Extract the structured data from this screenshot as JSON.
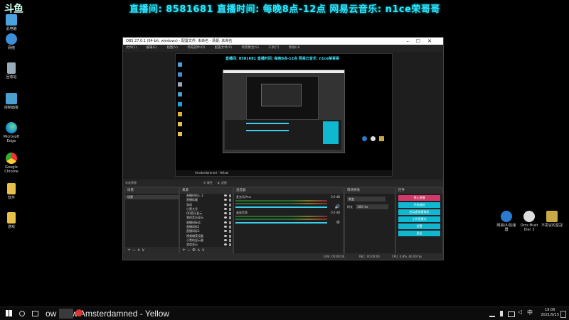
{
  "stream_logo": "斗鱼",
  "stream_banner": "直播间: 8581681 直播时间: 每晚8点-12点 网易云音乐: n1ce荣哥哥",
  "desktop_icons_left": [
    {
      "label": "此电脑",
      "color": "#4aa3df"
    },
    {
      "label": "网络",
      "color": "#3d8fd8"
    },
    {
      "label": "回收站",
      "color": "#9ab"
    },
    {
      "label": "控制面板",
      "color": "#4a9fd0"
    },
    {
      "label": "Microsoft Edge",
      "color": "#1aa1d8"
    },
    {
      "label": "Google Chrome",
      "color": "#e0b030"
    },
    {
      "label": "软件",
      "color": "#e6c04a"
    },
    {
      "label": "游戏",
      "color": "#e6c04a"
    }
  ],
  "desktop_icons_right": [
    {
      "label": "网易UU加速器",
      "color": "#2a7ad0"
    },
    {
      "label": "Orcs Must Die! 3",
      "color": "#ddd"
    },
    {
      "label": "不思议的皇冠",
      "color": "#c9a845"
    }
  ],
  "obs": {
    "title": "OBS 27.0.1 (64-bit, windows) - 配置文件: 未命名 - 场景: 未命名",
    "menu": [
      "文件(F)",
      "编辑(E)",
      "视图(V)",
      "停靠部件(D)",
      "配置文件(P)",
      "场景集合(S)",
      "工具(T)",
      "帮助(H)"
    ],
    "inner_banner": "直播间: 8581681 直播时间: 每晚8点-12点 网易云音乐: n1ce荣哥哥",
    "inner_now_playing": "Amsterdamned - Yellow",
    "scene_bar": {
      "label": "未选择源",
      "props": "属性",
      "filters": "滤镜"
    },
    "docks": {
      "scenes": {
        "title": "场景",
        "items": [
          "场景"
        ]
      },
      "sources": {
        "title": "来源",
        "items": [
          "直播时间上 2",
          "直播标题",
          "游戏",
          "小黑大号",
          "QQ音乐显示",
          "我的音乐显示",
          "直播间标志",
          "直播间标1",
          "直播间标3",
          "视频捕获设备",
          "小黑的显示器",
          "游戏显示"
        ]
      },
      "mixer": {
        "title": "混音器",
        "channels": [
          {
            "name": "麦克风/Aux",
            "db": "0.0 dB"
          },
          {
            "name": "桌面音频",
            "db": "0.0 dB"
          }
        ]
      },
      "transitions": {
        "title": "转场特效",
        "type": "渐变",
        "duration_label": "时长",
        "duration": "300 ms"
      },
      "controls": {
        "title": "控件",
        "buttons": [
          "停止直播",
          "开始录制",
          "启动虚拟摄像机",
          "工作室模式",
          "设置",
          "退出"
        ]
      }
    },
    "status": {
      "live": "LIVE: 00:00:00",
      "rec": "REC: 00:00:00",
      "cpu": "CPU: 0.8%, 60.00 fps"
    }
  },
  "taskbar": {
    "now_playing": "ow Claw  Amsterdamned - Yellow",
    "time": "19:06",
    "date": "2021/9/15"
  }
}
